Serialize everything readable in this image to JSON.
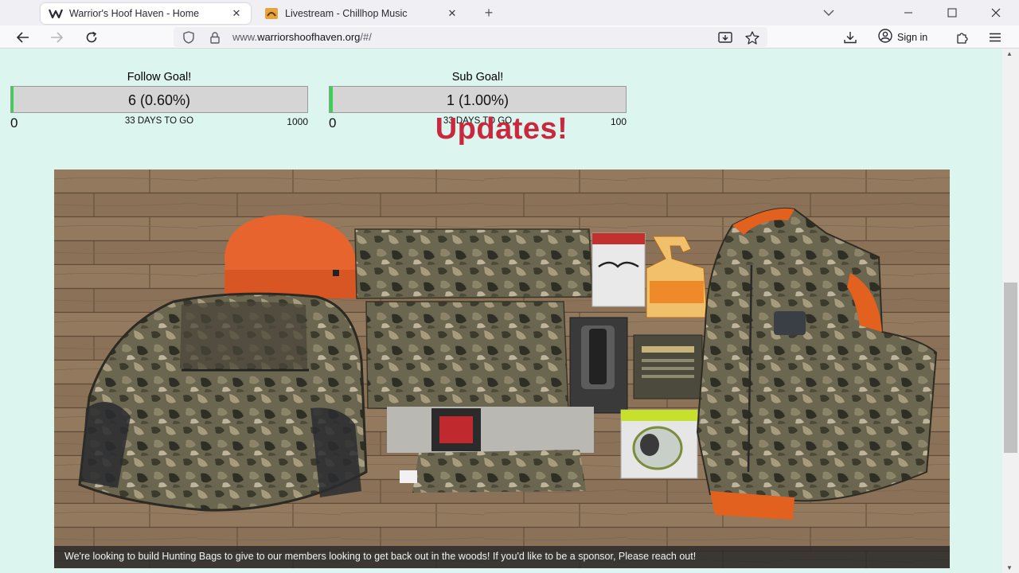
{
  "browser": {
    "tabs": [
      {
        "title": "Warrior's Hoof Haven - Home",
        "active": true,
        "favicon": "w-logo-icon"
      },
      {
        "title": "Livestream - Chillhop Music",
        "active": false,
        "favicon": "chillhop-icon"
      }
    ],
    "url_prefix": "www.",
    "url_domain": "warriorshoofhaven.org",
    "url_path": "/#/",
    "signin_label": "Sign in"
  },
  "goals": [
    {
      "title": "Follow Goal!",
      "bar_text": "6 (0.60%)",
      "progress_fraction": 0.006,
      "min": "0",
      "days": "33 DAYS TO GO",
      "max": "1000"
    },
    {
      "title": "Sub Goal!",
      "bar_text": "1 (1.00%)",
      "progress_fraction": 0.01,
      "min": "0",
      "days": "33 DAYS TO GO",
      "max": "100"
    }
  ],
  "updates_heading": "Updates!",
  "photo": {
    "caption": "We're looking to build Hunting Bags to give to our members looking to get back out in the woods! If you'd like to be a sponsor, Please reach out!"
  },
  "colors": {
    "page_bg": "#dcf5ee",
    "heading": "#c9283f",
    "progress_fill": "#39d353"
  }
}
